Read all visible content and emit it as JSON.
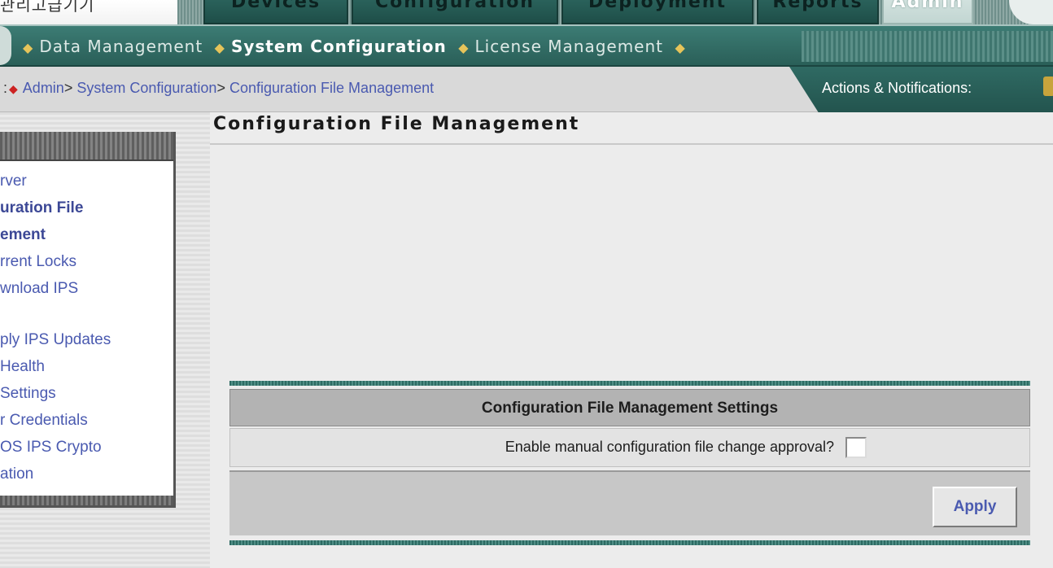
{
  "window": {
    "corner_text": "관리고급기기"
  },
  "main_tabs": [
    {
      "label": "Devices"
    },
    {
      "label": "Configuration"
    },
    {
      "label": "Deployment"
    },
    {
      "label": "Reports"
    },
    {
      "label": "Admin"
    }
  ],
  "subnav": {
    "items": [
      {
        "label": "Data Management"
      },
      {
        "label": "System Configuration"
      },
      {
        "label": "License Management"
      }
    ]
  },
  "breadcrumb": {
    "prefix": ":",
    "items": [
      "Admin",
      "System Configuration",
      "Configuration File Management"
    ],
    "separator": ">"
  },
  "actions": {
    "label": "Actions & Notifications:"
  },
  "sidebar": {
    "items": [
      {
        "label": "rver"
      },
      {
        "label": "uration File"
      },
      {
        "label": "ement"
      },
      {
        "label": "rrent Locks"
      },
      {
        "label": "wnload IPS"
      },
      {
        "label": "ply IPS Updates"
      },
      {
        "label": "Health"
      },
      {
        "label": "Settings"
      },
      {
        "label": "r Credentials"
      },
      {
        "label": "OS IPS Crypto"
      },
      {
        "label": "ation"
      }
    ]
  },
  "page": {
    "title": "Configuration File Management"
  },
  "settings": {
    "header": "Configuration File Management Settings",
    "question": "Enable manual configuration file change approval?",
    "checkbox_checked": false,
    "apply_label": "Apply"
  },
  "colors": {
    "teal": "#2f6a63",
    "link": "#4a5ab0",
    "accent": "#e6c45a"
  }
}
